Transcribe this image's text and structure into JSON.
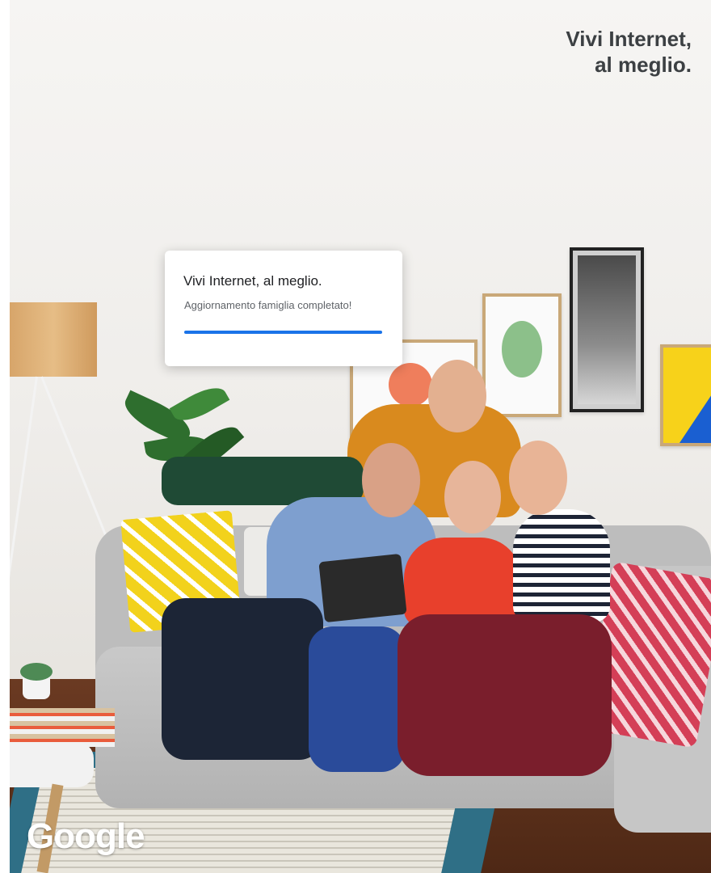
{
  "card": {
    "title": "Vivi Internet, al meglio.",
    "subtitle": "Aggiornamento famiglia completato!",
    "progress": 1.0,
    "bar_color": "#1a73e8"
  },
  "tagline": {
    "line1": "Vivi Internet,",
    "line2": "al meglio."
  },
  "logo": {
    "text": "Google"
  },
  "colors": {
    "text_dark": "#3c4043",
    "accent": "#1a73e8"
  }
}
